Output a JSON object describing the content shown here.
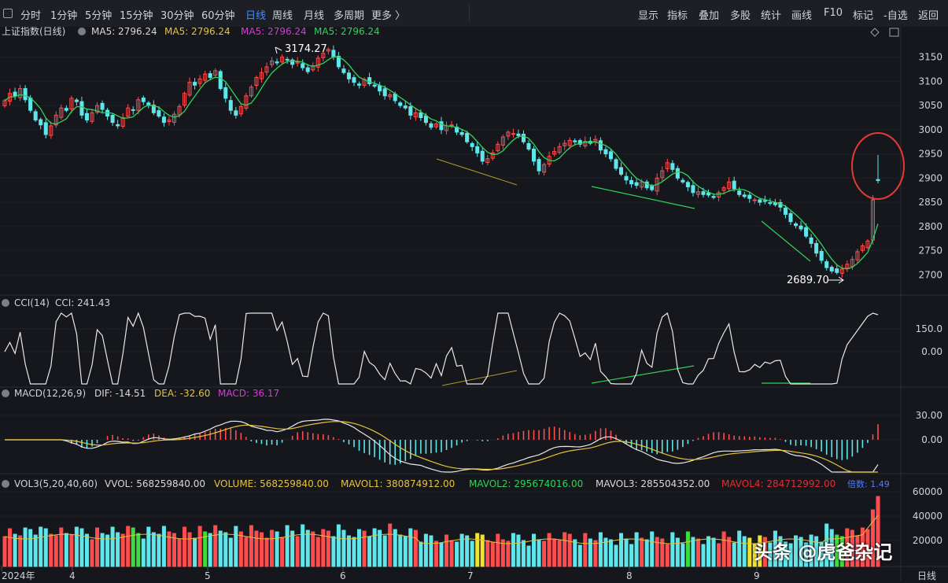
{
  "toolbar": {
    "left_items": [
      "分时",
      "1分钟",
      "5分钟",
      "15分钟",
      "30分钟",
      "60分钟",
      "日线",
      "周线",
      "月线",
      "多周期",
      "更多 〉"
    ],
    "active_index": 6,
    "right_items": [
      "显示",
      "指标",
      "叠加",
      "多股",
      "统计",
      "画线",
      "F10",
      "标记",
      "-自选",
      "返回"
    ]
  },
  "main_panel": {
    "title": "上证指数(日线)",
    "ma_labels": [
      {
        "text": "MA5: 2796.24",
        "color": "#d8d8d8"
      },
      {
        "text": "MA5: 2796.24",
        "color": "#e5c33a"
      },
      {
        "text": "MA5: 2796.24",
        "color": "#d63ad6"
      },
      {
        "text": "MA5: 2796.24",
        "color": "#2fd35a"
      }
    ],
    "y_ticks": [
      "3150",
      "3100",
      "3050",
      "3000",
      "2950",
      "2900",
      "2850",
      "2800",
      "2750",
      "2700"
    ],
    "high_label": "3174.27",
    "low_label": "2689.70"
  },
  "cci_panel": {
    "title": "CCI(14)",
    "value_label": "CCI: 241.43",
    "y_ticks": [
      "150.0",
      "0.00"
    ]
  },
  "macd_panel": {
    "title": "MACD(12,26,9)",
    "labels": [
      {
        "text": "DIF: -14.51",
        "color": "#d8d8d8"
      },
      {
        "text": "DEA: -32.60",
        "color": "#e5c33a"
      },
      {
        "text": "MACD: 36.17",
        "color": "#d63ad6"
      }
    ],
    "y_ticks": [
      "30.00",
      "0.00"
    ]
  },
  "vol_panel": {
    "title": "VOL3(5,20,40,60)",
    "labels": [
      {
        "text": "VVOL: 568259840.00",
        "color": "#d8d8d8"
      },
      {
        "text": "VOLUME: 568259840.00",
        "color": "#e5c33a"
      },
      {
        "text": "MAVOL1: 380874912.00",
        "color": "#e5c33a"
      },
      {
        "text": "MAVOL2: 295674016.00",
        "color": "#2fd35a"
      },
      {
        "text": "MAVOL3: 285504352.00",
        "color": "#d8d8d8"
      },
      {
        "text": "MAVOL4: 284712992.00",
        "color": "#e03030"
      },
      {
        "text": "倍数: 1.49",
        "color": "#4a7dff"
      }
    ],
    "y_ticks": [
      "60000",
      "40000",
      "20000"
    ]
  },
  "x_axis": {
    "labels": [
      "2024年",
      "4",
      "5",
      "6",
      "7",
      "8",
      "9"
    ],
    "period_label": "日线"
  },
  "watermark": "头条 @虎爸杂记",
  "colors": {
    "up": "#ff4d4f",
    "down": "#5ee6ea",
    "ma": "#2fd35a",
    "circle": "#e53935"
  },
  "chart_data": {
    "type": "candlestick",
    "price_range": [
      2660,
      3190
    ],
    "closes": [
      3060,
      3075,
      3070,
      3085,
      3062,
      3040,
      3020,
      3010,
      2990,
      3008,
      3030,
      3045,
      3040,
      3065,
      3058,
      3030,
      3020,
      3035,
      3050,
      3042,
      3028,
      3015,
      3008,
      3025,
      3045,
      3040,
      3062,
      3058,
      3050,
      3035,
      3028,
      3015,
      3020,
      3032,
      3048,
      3075,
      3098,
      3092,
      3105,
      3115,
      3108,
      3122,
      3085,
      3065,
      3040,
      3030,
      3048,
      3070,
      3088,
      3108,
      3118,
      3130,
      3142,
      3138,
      3150,
      3145,
      3135,
      3140,
      3128,
      3120,
      3132,
      3148,
      3158,
      3166,
      3150,
      3130,
      3118,
      3105,
      3098,
      3092,
      3104,
      3095,
      3090,
      3080,
      3070,
      3072,
      3060,
      3050,
      3045,
      3030,
      3035,
      3025,
      3015,
      3005,
      3012,
      3000,
      3008,
      3010,
      2995,
      2990,
      2975,
      2965,
      2952,
      2935,
      2940,
      2952,
      2970,
      2985,
      2995,
      2992,
      2988,
      2975,
      2960,
      2935,
      2915,
      2928,
      2945,
      2955,
      2965,
      2972,
      2978,
      2975,
      2970,
      2976,
      2972,
      2980,
      2958,
      2950,
      2940,
      2920,
      2908,
      2896,
      2888,
      2885,
      2892,
      2880,
      2876,
      2900,
      2915,
      2932,
      2918,
      2900,
      2892,
      2882,
      2870,
      2872,
      2866,
      2865,
      2860,
      2870,
      2880,
      2892,
      2878,
      2866,
      2862,
      2858,
      2855,
      2850,
      2852,
      2848,
      2845,
      2840,
      2825,
      2810,
      2802,
      2795,
      2780,
      2765,
      2745,
      2730,
      2715,
      2708,
      2705,
      2712,
      2722,
      2732,
      2748,
      2760,
      2770,
      2855,
      2895
    ]
  }
}
